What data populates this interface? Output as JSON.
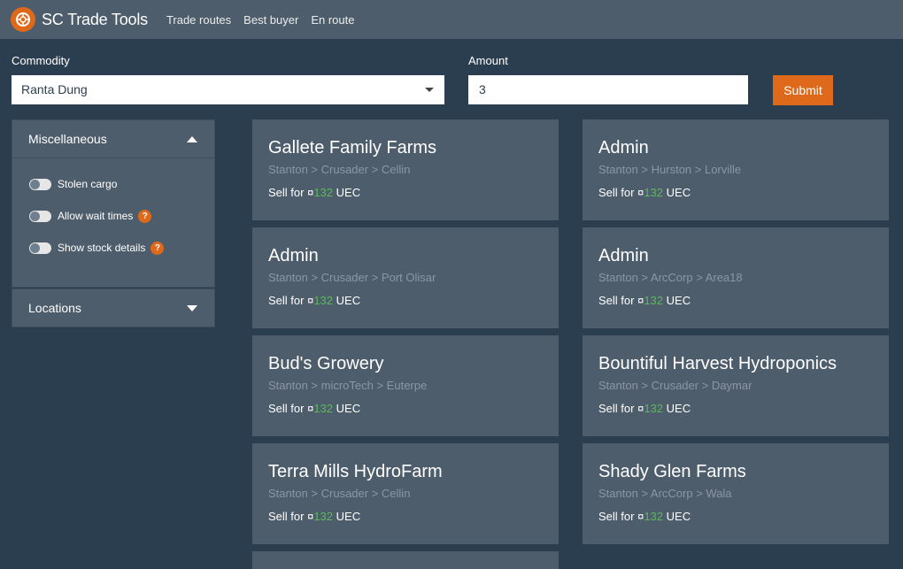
{
  "header": {
    "brand": "SC Trade Tools",
    "nav": [
      "Trade routes",
      "Best buyer",
      "En route"
    ]
  },
  "form": {
    "commodity_label": "Commodity",
    "commodity_value": "Ranta Dung",
    "amount_label": "Amount",
    "amount_value": "3",
    "submit_label": "Submit"
  },
  "sidebar": {
    "misc_title": "Miscellaneous",
    "options": [
      {
        "label": "Stolen cargo",
        "help": false
      },
      {
        "label": "Allow wait times",
        "help": true
      },
      {
        "label": "Show stock details",
        "help": true
      }
    ],
    "locations_title": "Locations",
    "help_glyph": "?"
  },
  "results": {
    "sell_prefix": "Sell for ¤",
    "currency": "UEC",
    "cards": [
      {
        "name": "Gallete Family Farms",
        "path": "Stanton > Crusader > Cellin",
        "price": "132"
      },
      {
        "name": "Admin",
        "path": "Stanton > Hurston > Lorville",
        "price": "132"
      },
      {
        "name": "Admin",
        "path": "Stanton > Crusader > Port Olisar",
        "price": "132"
      },
      {
        "name": "Admin",
        "path": "Stanton > ArcCorp > Area18",
        "price": "132"
      },
      {
        "name": "Bud's Growery",
        "path": "Stanton > microTech > Euterpe",
        "price": "132"
      },
      {
        "name": "Bountiful Harvest Hydroponics",
        "path": "Stanton > Crusader > Daymar",
        "price": "132"
      },
      {
        "name": "Terra Mills HydroFarm",
        "path": "Stanton > Crusader > Cellin",
        "price": "132"
      },
      {
        "name": "Shady Glen Farms",
        "path": "Stanton > ArcCorp > Wala",
        "price": "132"
      }
    ]
  },
  "colors": {
    "accent": "#df691a",
    "background": "#2b3e50",
    "panel": "#4e5d6c",
    "price": "#5cb85c"
  }
}
